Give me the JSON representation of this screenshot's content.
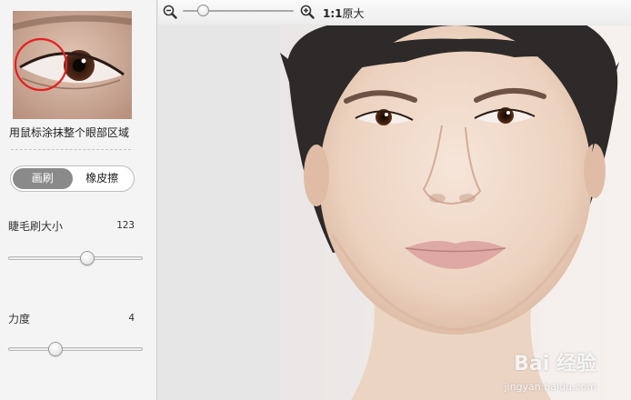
{
  "sidebar": {
    "hint_text": "用鼠标涂抹整个眼部区域",
    "mode_buttons": {
      "brush": "画刷",
      "eraser": "橡皮擦",
      "active": "brush"
    },
    "params": [
      {
        "label": "睫毛刷大小",
        "value": "123",
        "level": 0.59
      },
      {
        "label": "力度",
        "value": "4",
        "level": 0.35
      }
    ]
  },
  "toolbar": {
    "zoom_out_icon": "zoom-out-icon",
    "zoom_in_icon": "zoom-in-icon",
    "zoom_level": 0.18,
    "actual_size_bold": "1:1",
    "actual_size_label": "原大"
  },
  "watermark": {
    "brand": "Bai 经验",
    "url": "jingyan.baidu.com"
  },
  "colors": {
    "active_segment": "#8a8a8a",
    "highlight_circle": "#e52020"
  }
}
